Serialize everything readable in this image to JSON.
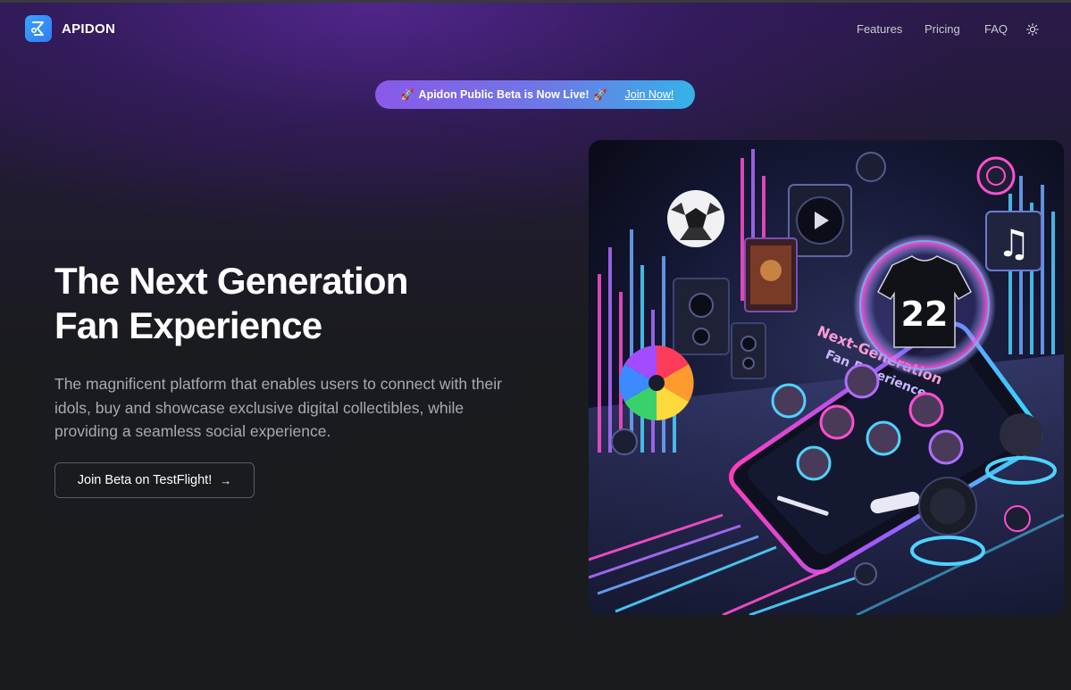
{
  "brand": {
    "name": "APIDON"
  },
  "nav": {
    "features": "Features",
    "pricing": "Pricing",
    "faq": "FAQ",
    "theme_icon": "sun-icon"
  },
  "banner": {
    "message": "Apidon Public Beta is Now Live!",
    "link": "Join Now!",
    "icon": "rocket-icon"
  },
  "hero": {
    "title_line1": "The Next Generation",
    "title_line2": "Fan Experience",
    "description": "The magnificent platform that enables users to connect with their idols, buy and showcase exclusive digital collectibles, while providing a seamless social experience.",
    "cta_label": "Join Beta on TestFlight!",
    "cta_icon": "arrow-right-icon"
  },
  "illustration": {
    "jersey_number": "22",
    "screen_heading_1": "Next-Generation",
    "screen_heading_2": "Fan Experience"
  },
  "colors": {
    "background": "#1a1b1f",
    "glow": "#582896",
    "banner_start": "#8a59e8",
    "banner_end": "#35b2e8",
    "logo": "#3aa3ff"
  }
}
